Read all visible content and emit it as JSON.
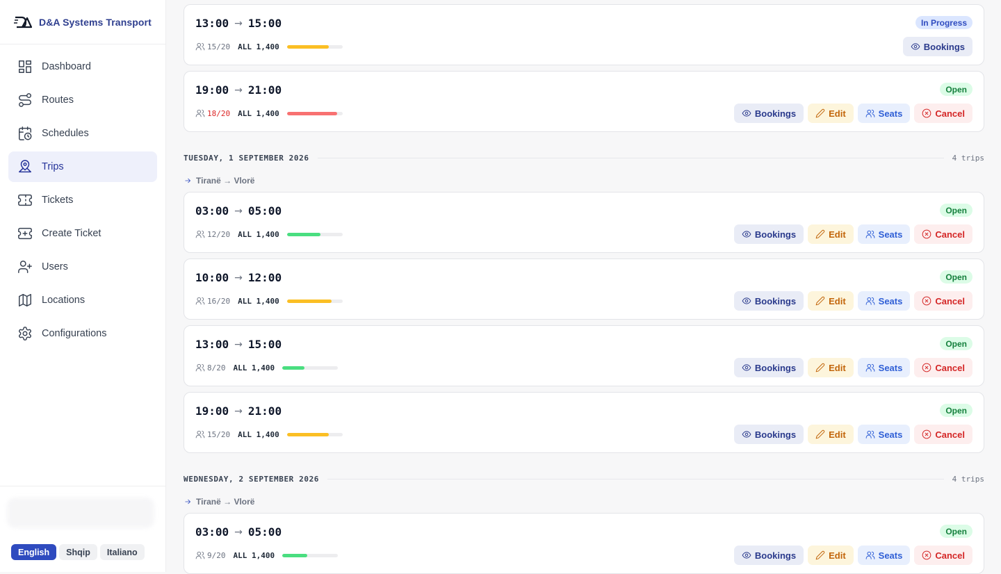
{
  "brand": {
    "name": "D&A Systems Transport"
  },
  "sidebar": {
    "items": [
      {
        "label": "Dashboard",
        "icon": "dashboard-icon"
      },
      {
        "label": "Routes",
        "icon": "routes-icon"
      },
      {
        "label": "Schedules",
        "icon": "calendar-clock-icon"
      },
      {
        "label": "Trips",
        "icon": "map-pin-icon",
        "active": true
      },
      {
        "label": "Tickets",
        "icon": "ticket-icon"
      },
      {
        "label": "Create Ticket",
        "icon": "ticket-plus-icon"
      },
      {
        "label": "Users",
        "icon": "user-plus-icon"
      },
      {
        "label": "Locations",
        "icon": "map-icon"
      },
      {
        "label": "Configurations",
        "icon": "gear-icon"
      }
    ],
    "languages": [
      {
        "label": "English",
        "active": true
      },
      {
        "label": "Shqip",
        "active": false
      },
      {
        "label": "Italiano",
        "active": false
      }
    ]
  },
  "actions": {
    "bookings": "Bookings",
    "edit": "Edit",
    "seats": "Seats",
    "cancel": "Cancel"
  },
  "status_labels": {
    "open": "Open",
    "in_progress": "In Progress"
  },
  "top_trips": [
    {
      "depart": "13:00",
      "arrive": "15:00",
      "seats": "15/20",
      "price": "ALL 1,400",
      "fill": 0.75,
      "status": "In Progress"
    },
    {
      "depart": "19:00",
      "arrive": "21:00",
      "seats": "18/20",
      "price": "ALL 1,400",
      "fill": 0.9,
      "status": "Open"
    }
  ],
  "days": [
    {
      "title": "TUESDAY, 1 SEPTEMBER 2026",
      "count": "4 trips",
      "route": "Tiranë → Vlorë",
      "trips": [
        {
          "depart": "03:00",
          "arrive": "05:00",
          "seats": "12/20",
          "price": "ALL 1,400",
          "fill": 0.6,
          "status": "Open"
        },
        {
          "depart": "10:00",
          "arrive": "12:00",
          "seats": "16/20",
          "price": "ALL 1,400",
          "fill": 0.8,
          "status": "Open"
        },
        {
          "depart": "13:00",
          "arrive": "15:00",
          "seats": "8/20",
          "price": "ALL 1,400",
          "fill": 0.4,
          "status": "Open"
        },
        {
          "depart": "19:00",
          "arrive": "21:00",
          "seats": "15/20",
          "price": "ALL 1,400",
          "fill": 0.75,
          "status": "Open"
        }
      ]
    },
    {
      "title": "WEDNESDAY, 2 SEPTEMBER 2026",
      "count": "4 trips",
      "route": "Tiranë → Vlorë",
      "trips": [
        {
          "depart": "03:00",
          "arrive": "05:00",
          "seats": "9/20",
          "price": "ALL 1,400",
          "fill": 0.45,
          "status": "Open"
        }
      ]
    }
  ],
  "colors": {
    "accent": "#2f4bbf",
    "fill_low": "#4ade80",
    "fill_mid": "#fbbf24",
    "fill_high": "#f87171"
  }
}
